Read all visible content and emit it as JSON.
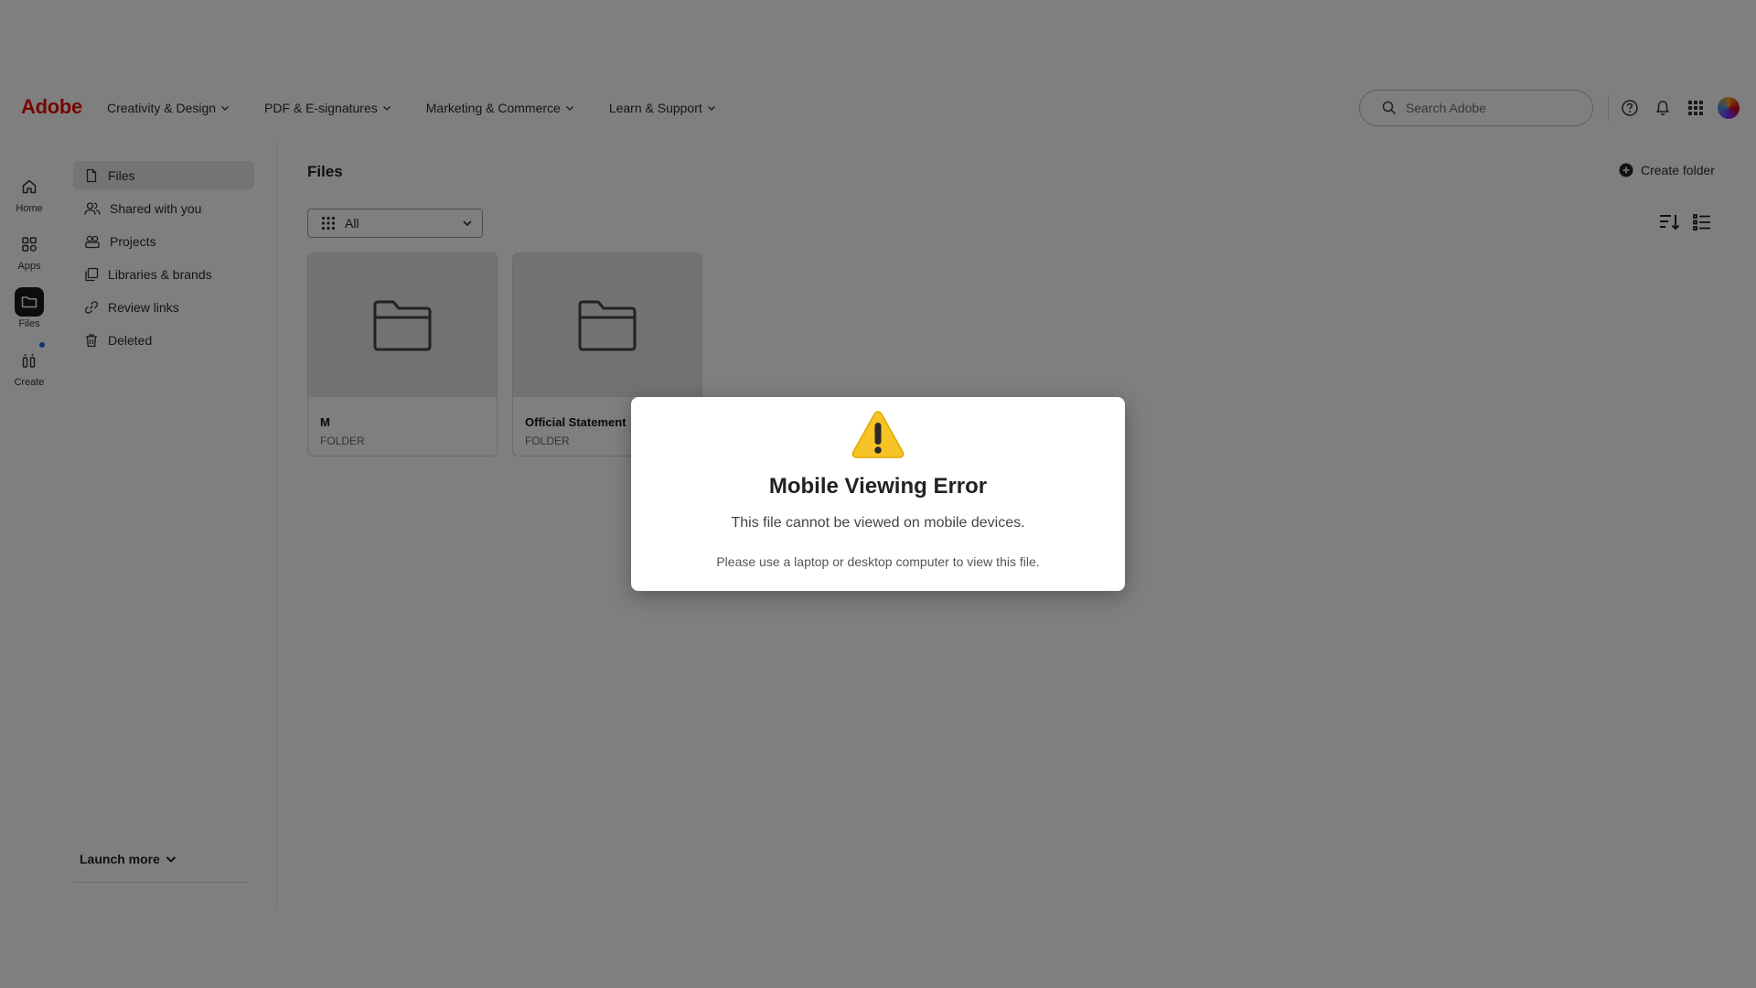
{
  "brand": {
    "name": "Adobe",
    "color": "#eb1000"
  },
  "nav": [
    {
      "label": "Creativity & Design"
    },
    {
      "label": "PDF & E-signatures"
    },
    {
      "label": "Marketing & Commerce"
    },
    {
      "label": "Learn & Support"
    }
  ],
  "search": {
    "placeholder": "Search Adobe"
  },
  "rail": [
    {
      "label": "Home",
      "icon": "home-icon"
    },
    {
      "label": "Apps",
      "icon": "apps-icon"
    },
    {
      "label": "Files",
      "icon": "folder-icon"
    },
    {
      "label": "Create",
      "icon": "create-icon"
    }
  ],
  "sidebar": {
    "items": [
      {
        "label": "Files",
        "icon": "file-icon"
      },
      {
        "label": "Shared with you",
        "icon": "people-icon"
      },
      {
        "label": "Projects",
        "icon": "projects-icon"
      },
      {
        "label": "Libraries & brands",
        "icon": "libraries-icon"
      },
      {
        "label": "Review links",
        "icon": "link-icon"
      },
      {
        "label": "Deleted",
        "icon": "trash-icon"
      }
    ],
    "launch_more": "Launch more"
  },
  "main": {
    "title": "Files",
    "create_folder": "Create folder",
    "filter": {
      "selected": "All"
    },
    "cards": [
      {
        "name": "M",
        "type": "FOLDER"
      },
      {
        "name": "Official Statement",
        "type": "FOLDER"
      }
    ]
  },
  "modal": {
    "title": "Mobile Viewing Error",
    "message": "This file cannot be viewed on mobile devices.",
    "hint": "Please use a laptop or desktop computer to view this file."
  }
}
